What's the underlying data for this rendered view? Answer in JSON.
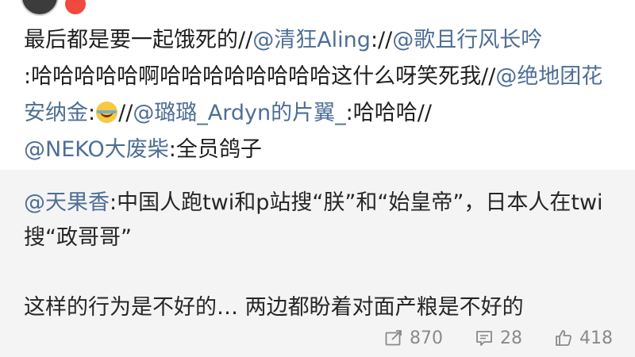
{
  "post": {
    "line1_prefix": "最后都是要一起饿死的//",
    "m_qingkuang": "@清狂Aling",
    "sep1": "://",
    "m_geqie": "@歌且行风长吟",
    "sep2": ":",
    "text_haha": "哈哈哈哈哈啊哈哈哈哈哈哈哈哈这什么呀笑死我//",
    "m_juedi": "@绝地团花安纳金",
    "sep3": ":",
    "emoji_name": "laugh-cry-icon",
    "sep4": "//",
    "m_lulu": "@璐璐_Ardyn的片翼_",
    "text_haha2": ":哈哈哈//",
    "m_neko": "@NEKO大废柴",
    "text_tail": ":全员鸽子"
  },
  "quote": {
    "author": "@天果香",
    "line1": ":中国人跑twi和p站搜“朕”和“始皇帝”，日本人在twi搜“政哥哥”",
    "line2": "这样的行为是不好的… 两边都盼着对面产粮是不好的"
  },
  "actions": {
    "repost_count": "870",
    "comment_count": "28",
    "like_count": "418"
  },
  "colors": {
    "mention": "#4e6e96",
    "quote_bg": "#f4f4f4",
    "action_gray": "#8a8a8a"
  }
}
